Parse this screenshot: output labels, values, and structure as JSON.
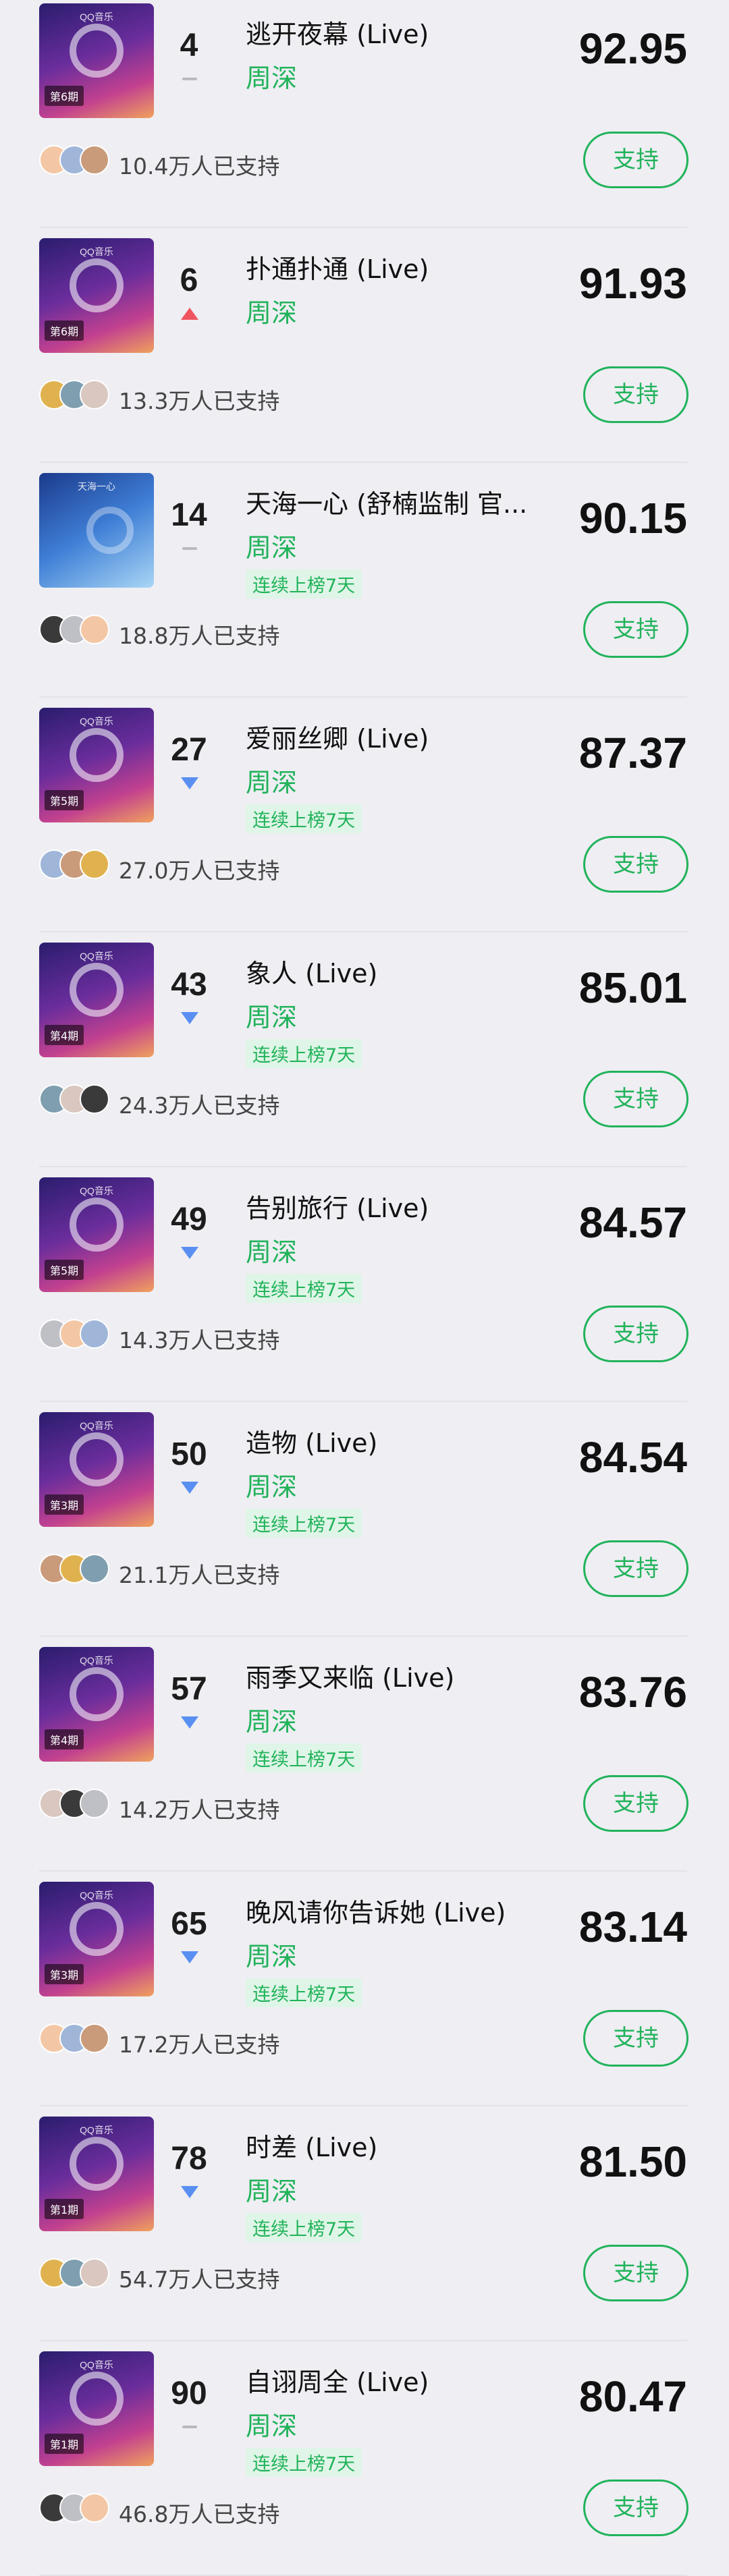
{
  "support_label": "支持",
  "streak_label": "连续上榜7天",
  "items": [
    {
      "rank": "4",
      "trend": "flat",
      "title": "逃开夜幕 (Live)",
      "artist": "周深",
      "score": "92.95",
      "support_count": "10.4万人已支持",
      "cover_badge": "QQ音乐",
      "episode": "第6期",
      "streak": false,
      "cover": "stage"
    },
    {
      "rank": "6",
      "trend": "up",
      "title": "扑通扑通 (Live)",
      "artist": "周深",
      "score": "91.93",
      "support_count": "13.3万人已支持",
      "cover_badge": "QQ音乐",
      "episode": "第6期",
      "streak": false,
      "cover": "stage"
    },
    {
      "rank": "14",
      "trend": "flat",
      "title": "天海一心 (舒楠监制 官...",
      "artist": "周深",
      "score": "90.15",
      "support_count": "18.8万人已支持",
      "cover_badge": "天海一心",
      "episode": "",
      "streak": true,
      "cover": "alt"
    },
    {
      "rank": "27",
      "trend": "down",
      "title": "爱丽丝卿 (Live)",
      "artist": "周深",
      "score": "87.37",
      "support_count": "27.0万人已支持",
      "cover_badge": "QQ音乐",
      "episode": "第5期",
      "streak": true,
      "cover": "stage"
    },
    {
      "rank": "43",
      "trend": "down",
      "title": "象人 (Live)",
      "artist": "周深",
      "score": "85.01",
      "support_count": "24.3万人已支持",
      "cover_badge": "QQ音乐",
      "episode": "第4期",
      "streak": true,
      "cover": "stage"
    },
    {
      "rank": "49",
      "trend": "down",
      "title": "告别旅行 (Live)",
      "artist": "周深",
      "score": "84.57",
      "support_count": "14.3万人已支持",
      "cover_badge": "QQ音乐",
      "episode": "第5期",
      "streak": true,
      "cover": "stage"
    },
    {
      "rank": "50",
      "trend": "down",
      "title": "造物 (Live)",
      "artist": "周深",
      "score": "84.54",
      "support_count": "21.1万人已支持",
      "cover_badge": "QQ音乐",
      "episode": "第3期",
      "streak": true,
      "cover": "stage"
    },
    {
      "rank": "57",
      "trend": "down",
      "title": "雨季又来临 (Live)",
      "artist": "周深",
      "score": "83.76",
      "support_count": "14.2万人已支持",
      "cover_badge": "QQ音乐",
      "episode": "第4期",
      "streak": true,
      "cover": "stage"
    },
    {
      "rank": "65",
      "trend": "down",
      "title": "晚风请你告诉她 (Live)",
      "artist": "周深",
      "score": "83.14",
      "support_count": "17.2万人已支持",
      "cover_badge": "QQ音乐",
      "episode": "第3期",
      "streak": true,
      "cover": "stage"
    },
    {
      "rank": "78",
      "trend": "down",
      "title": "时差 (Live)",
      "artist": "周深",
      "score": "81.50",
      "support_count": "54.7万人已支持",
      "cover_badge": "QQ音乐",
      "episode": "第1期",
      "streak": true,
      "cover": "stage"
    },
    {
      "rank": "90",
      "trend": "flat",
      "title": "自诩周全 (Live)",
      "artist": "周深",
      "score": "80.47",
      "support_count": "46.8万人已支持",
      "cover_badge": "QQ音乐",
      "episode": "第1期",
      "streak": true,
      "cover": "stage"
    }
  ],
  "colors": {
    "accent_green": "#21b35a",
    "trend_up": "#f0545f",
    "trend_down": "#5a8ff2",
    "trend_flat": "#b9b9be",
    "background": "#eeeef3"
  },
  "avatar_palette": [
    "#f3c7a5",
    "#9fb6d9",
    "#c99b7a",
    "#e0b24f",
    "#7f9fb0",
    "#d9c7c0",
    "#3a3a3a",
    "#bfbfc6"
  ]
}
